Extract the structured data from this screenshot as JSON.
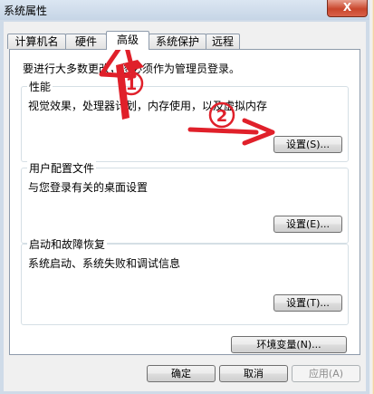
{
  "window": {
    "title": "系统属性",
    "close_label": "X"
  },
  "tabs": [
    {
      "label": "计算机名"
    },
    {
      "label": "硬件"
    },
    {
      "label": "高级"
    },
    {
      "label": "系统保护"
    },
    {
      "label": "远程"
    }
  ],
  "active_tab": "高级",
  "admin_note": "要进行大多数更改，您必须作为管理员登录。",
  "performance": {
    "title": "性能",
    "description": "视觉效果，处理器计划，内存使用，以及虚拟内存",
    "settings_button": "设置(S)..."
  },
  "user_profiles": {
    "title": "用户配置文件",
    "description": "与您登录有关的桌面设置",
    "settings_button": "设置(E)..."
  },
  "startup_recovery": {
    "title": "启动和故障恢复",
    "description": "系统启动、系统失败和调试信息",
    "settings_button": "设置(T)..."
  },
  "env_variables_button": "环境变量(N)...",
  "footer": {
    "ok": "确定",
    "cancel": "取消",
    "apply": "应用(A)"
  },
  "annotations": {
    "step1_label": "1",
    "step2_label": "2",
    "color": "#e0202a"
  }
}
